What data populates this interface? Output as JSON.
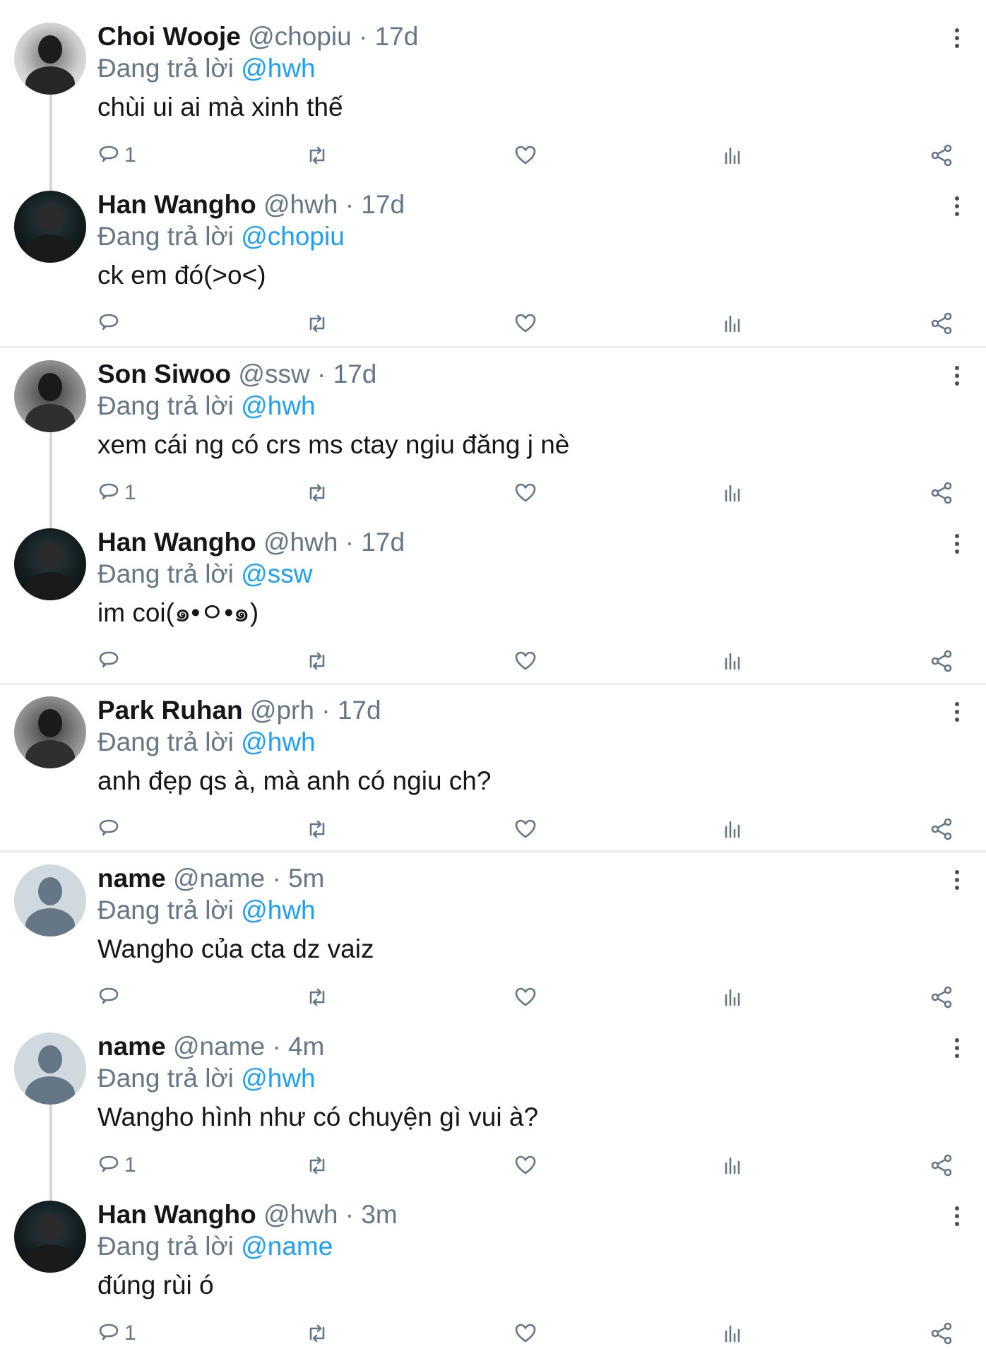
{
  "tweets": [
    {
      "name": "Choi Wooje",
      "handle": "@chopiu",
      "dot": "·",
      "time": "17d",
      "reply_prefix": "Đang trả lời",
      "reply_to": "@hwh",
      "text": "chùi ui ai mà xinh thế",
      "reply_count": "1",
      "avatar": "photo-light"
    },
    {
      "name": "Han Wangho",
      "handle": "@hwh",
      "dot": "·",
      "time": "17d",
      "reply_prefix": "Đang trả lời",
      "reply_to": "@chopiu",
      "text": "ck em đó(>o<)",
      "reply_count": "",
      "avatar": "dark"
    },
    {
      "name": "Son Siwoo",
      "handle": "@ssw",
      "dot": "·",
      "time": "17d",
      "reply_prefix": "Đang trả lời",
      "reply_to": "@hwh",
      "text": "xem cái ng có crs ms ctay ngiu đăng j nè",
      "reply_count": "1",
      "avatar": "photo-mid"
    },
    {
      "name": "Han Wangho",
      "handle": "@hwh",
      "dot": "·",
      "time": "17d",
      "reply_prefix": "Đang trả lời",
      "reply_to": "@ssw",
      "text": "im coi(๑•ㅇ•๑)",
      "reply_count": "",
      "avatar": "dark"
    },
    {
      "name": "Park Ruhan",
      "handle": "@prh",
      "dot": "·",
      "time": "17d",
      "reply_prefix": "Đang trả lời",
      "reply_to": "@hwh",
      "text": "anh đẹp qs à, mà anh có ngiu ch?",
      "reply_count": "",
      "avatar": "photo-mid"
    },
    {
      "name": "name",
      "handle": "@name",
      "dot": "·",
      "time": "5m",
      "reply_prefix": "Đang trả lời",
      "reply_to": "@hwh",
      "text": "Wangho của cta dz vaiz",
      "reply_count": "",
      "avatar": "default"
    },
    {
      "name": "name",
      "handle": "@name",
      "dot": "·",
      "time": "4m",
      "reply_prefix": "Đang trả lời",
      "reply_to": "@hwh",
      "text": "Wangho hình như có chuyện gì vui à?",
      "reply_count": "1",
      "avatar": "default"
    },
    {
      "name": "Han Wangho",
      "handle": "@hwh",
      "dot": "·",
      "time": "3m",
      "reply_prefix": "Đang trả lời",
      "reply_to": "@name",
      "text": "đúng rùi ó",
      "reply_count": "1",
      "avatar": "dark"
    }
  ],
  "icons": {
    "reply": "reply-icon",
    "retweet": "retweet-icon",
    "like": "heart-icon",
    "analytics": "analytics-icon",
    "share": "share-icon",
    "more": "more-vertical-icon"
  },
  "colors": {
    "link": "#1da1f2",
    "secondary_text": "#657786",
    "divider": "#e6ecf0"
  }
}
